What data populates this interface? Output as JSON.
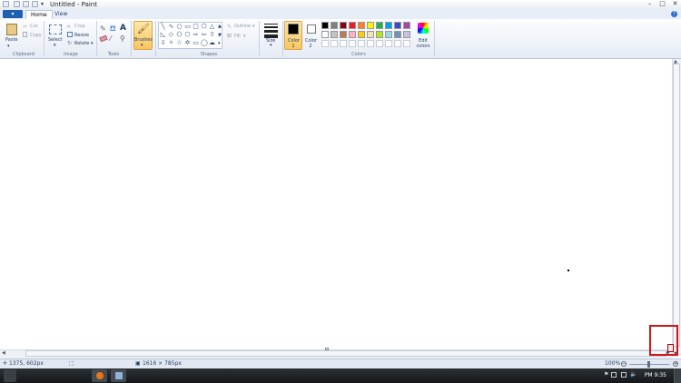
{
  "window": {
    "title": "Untitled - Paint",
    "controls": [
      "–",
      "□",
      "✕"
    ]
  },
  "tabs": {
    "file_label": "▾",
    "home": "Home",
    "view": "View"
  },
  "ribbon": {
    "clipboard": {
      "group": "Clipboard",
      "paste": "Paste",
      "cut": "Cut",
      "copy": "Copy"
    },
    "image": {
      "group": "Image",
      "select": "Select",
      "crop": "Crop",
      "resize": "Resize",
      "rotate": "Rotate"
    },
    "tools": {
      "group": "Tools",
      "text_tool": "A"
    },
    "brushes": "Brushes",
    "shapes": {
      "group": "Shapes",
      "outline": "Outline",
      "fill": "Fill"
    },
    "size": "Size",
    "colors": {
      "group": "Colors",
      "color1": "Color 1",
      "color2": "Color 2",
      "edit": "Edit colors",
      "color1_value": "#000000",
      "color2_value": "#ffffff",
      "row1": [
        "#000000",
        "#7f7f7f",
        "#880015",
        "#ed1c24",
        "#ff7f27",
        "#fff200",
        "#22b14c",
        "#00a2e8",
        "#3f48cc",
        "#a349a4"
      ],
      "row2": [
        "#ffffff",
        "#c3c3c3",
        "#b97a57",
        "#ffaec9",
        "#ffc90e",
        "#efe4b0",
        "#b5e61d",
        "#99d9ea",
        "#7092be",
        "#c8bfe7"
      ]
    }
  },
  "status": {
    "cursor_pos": "1375, 602px",
    "image_size": "1616 × 785px",
    "zoom": "100%"
  },
  "taskbar": {
    "time": "PM 9:35"
  }
}
